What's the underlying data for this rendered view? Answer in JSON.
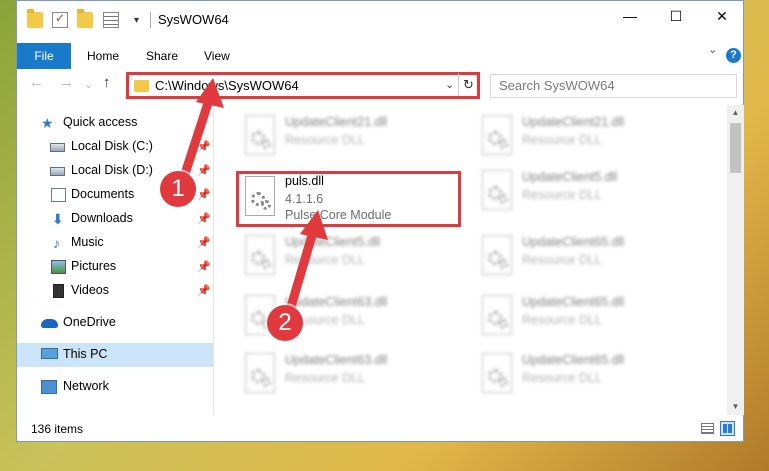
{
  "window": {
    "title": "SysWOW64"
  },
  "window_controls": {
    "minimize": "—",
    "maximize": "☐",
    "close": "✕"
  },
  "quick_access_arrow": "▾",
  "ribbon": {
    "tabs": [
      "File",
      "Home",
      "Share",
      "View"
    ],
    "expand": "⌄",
    "help": "?"
  },
  "nav": {
    "back": "←",
    "forward": "→",
    "recent": "⌄",
    "up": "↑",
    "address": "C:\\Windows\\SysWOW64",
    "address_chevron": "⌄",
    "refresh": "↻",
    "search_placeholder": "Search SysWOW64"
  },
  "sidebar": {
    "items": [
      {
        "label": "Quick access",
        "icon": "star-icon"
      },
      {
        "label": "Local Disk (C:)",
        "icon": "disk-icon",
        "pinned": true
      },
      {
        "label": "Local Disk (D:)",
        "icon": "disk-icon",
        "pinned": true
      },
      {
        "label": "Documents",
        "icon": "documents-icon",
        "pinned": true
      },
      {
        "label": "Downloads",
        "icon": "download-icon",
        "pinned": true
      },
      {
        "label": "Music",
        "icon": "music-icon",
        "pinned": true
      },
      {
        "label": "Pictures",
        "icon": "pictures-icon",
        "pinned": true
      },
      {
        "label": "Videos",
        "icon": "videos-icon",
        "pinned": true
      },
      {
        "label": "OneDrive",
        "icon": "onedrive-icon"
      },
      {
        "label": "This PC",
        "icon": "pc-icon",
        "selected": true
      },
      {
        "label": "Network",
        "icon": "network-icon"
      }
    ],
    "pin_glyph": "📌"
  },
  "files": [
    {
      "name": "UpdateClient21.dll",
      "desc": "Resource DLL"
    },
    {
      "name": "UpdateClient21.dll",
      "desc": "Resource DLL"
    },
    {
      "name": "puls.dll",
      "version": "4.1.1.6",
      "desc": "Pulse Core Module",
      "highlighted": true
    },
    {
      "name": "UpdateClient5.dll",
      "desc": "Resource DLL"
    },
    {
      "name": "UpdateClient5.dll",
      "desc": "Resource DLL"
    },
    {
      "name": "UpdateClient65.dll",
      "desc": "Resource DLL"
    },
    {
      "name": "UpdateClient63.dll",
      "desc": "Resource DLL"
    },
    {
      "name": "UpdateClient65.dll",
      "desc": "Resource DLL"
    },
    {
      "name": "UpdateClient63.dll",
      "desc": "Resource DLL"
    },
    {
      "name": "UpdateClient65.dll",
      "desc": "Resource DLL"
    }
  ],
  "scroll": {
    "up": "▲",
    "down": "▼"
  },
  "status": {
    "item_count": "136 items"
  },
  "markers": [
    "1",
    "2"
  ],
  "colors": {
    "accent": "#1979ca",
    "highlight_red": "#e0393e",
    "selected_bg": "#cce4f7"
  }
}
